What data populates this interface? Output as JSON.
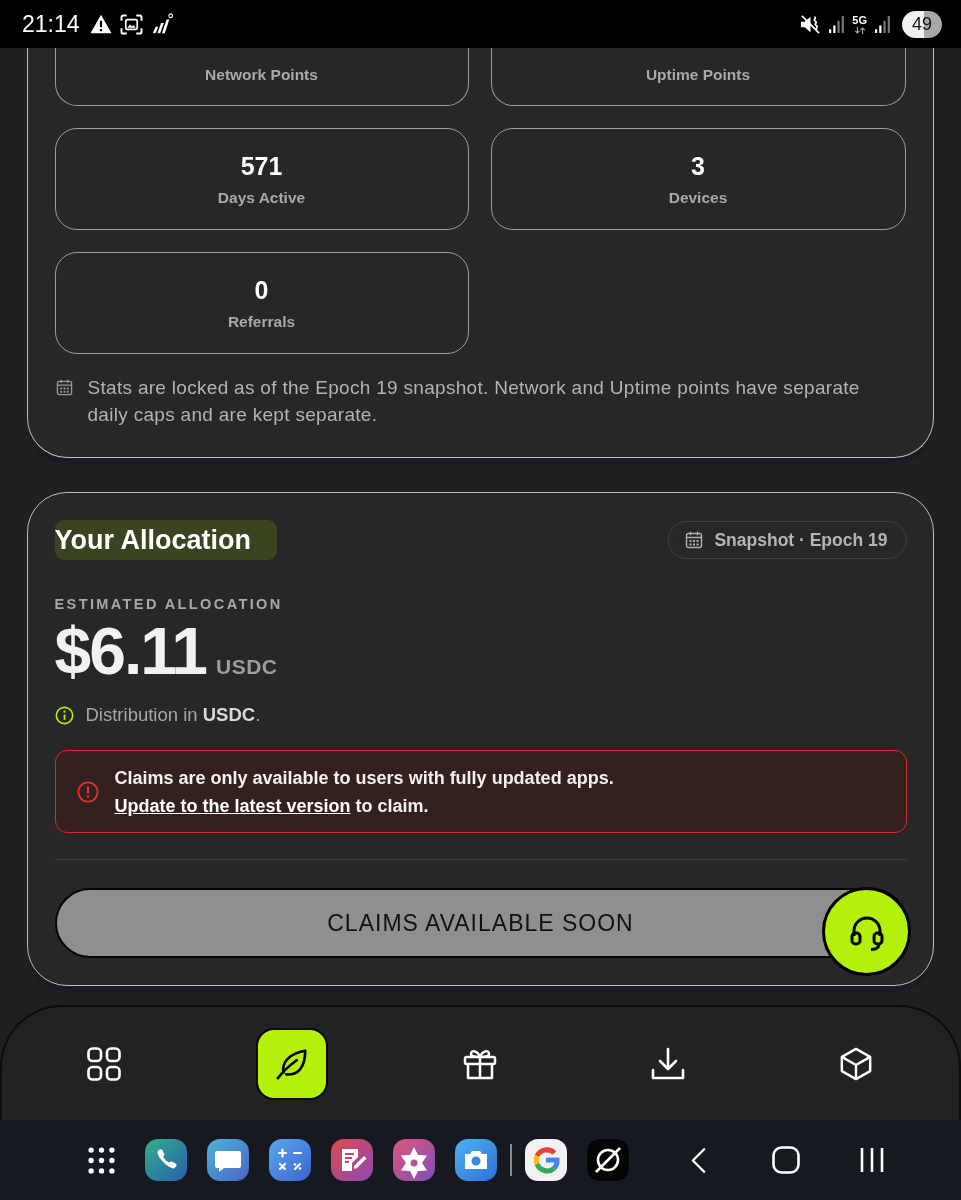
{
  "status_bar": {
    "time": "21:14",
    "network": "5G",
    "battery": "49"
  },
  "stats_card": {
    "stats": [
      {
        "label": "Network Points"
      },
      {
        "label": "Uptime Points"
      },
      {
        "value": "571",
        "label": "Days Active"
      },
      {
        "value": "3",
        "label": "Devices"
      },
      {
        "value": "0",
        "label": "Referrals"
      }
    ],
    "note": "Stats are locked as of the Epoch 19 snapshot. Network and Uptime points have separate daily caps and are kept separate."
  },
  "allocation_card": {
    "title": "Your Allocation",
    "badge": "Snapshot · Epoch 19",
    "caption": "ESTIMATED ALLOCATION",
    "amount": "$6.11",
    "currency": "USDC",
    "distribution": "Distribution in **USDC**.",
    "alert": {
      "message": "Claims are only available to users with fully updated apps.",
      "link": "Update to the latest version",
      "suffix": "to claim."
    },
    "claim_button": {
      "label": "CLAIMS AVAILABLE SOON",
      "disabled": true
    }
  },
  "bottom_nav": {
    "items": [
      {
        "selected": false
      },
      {
        "selected": true
      },
      {
        "selected": false
      },
      {
        "selected": false
      },
      {
        "selected": false
      }
    ]
  }
}
